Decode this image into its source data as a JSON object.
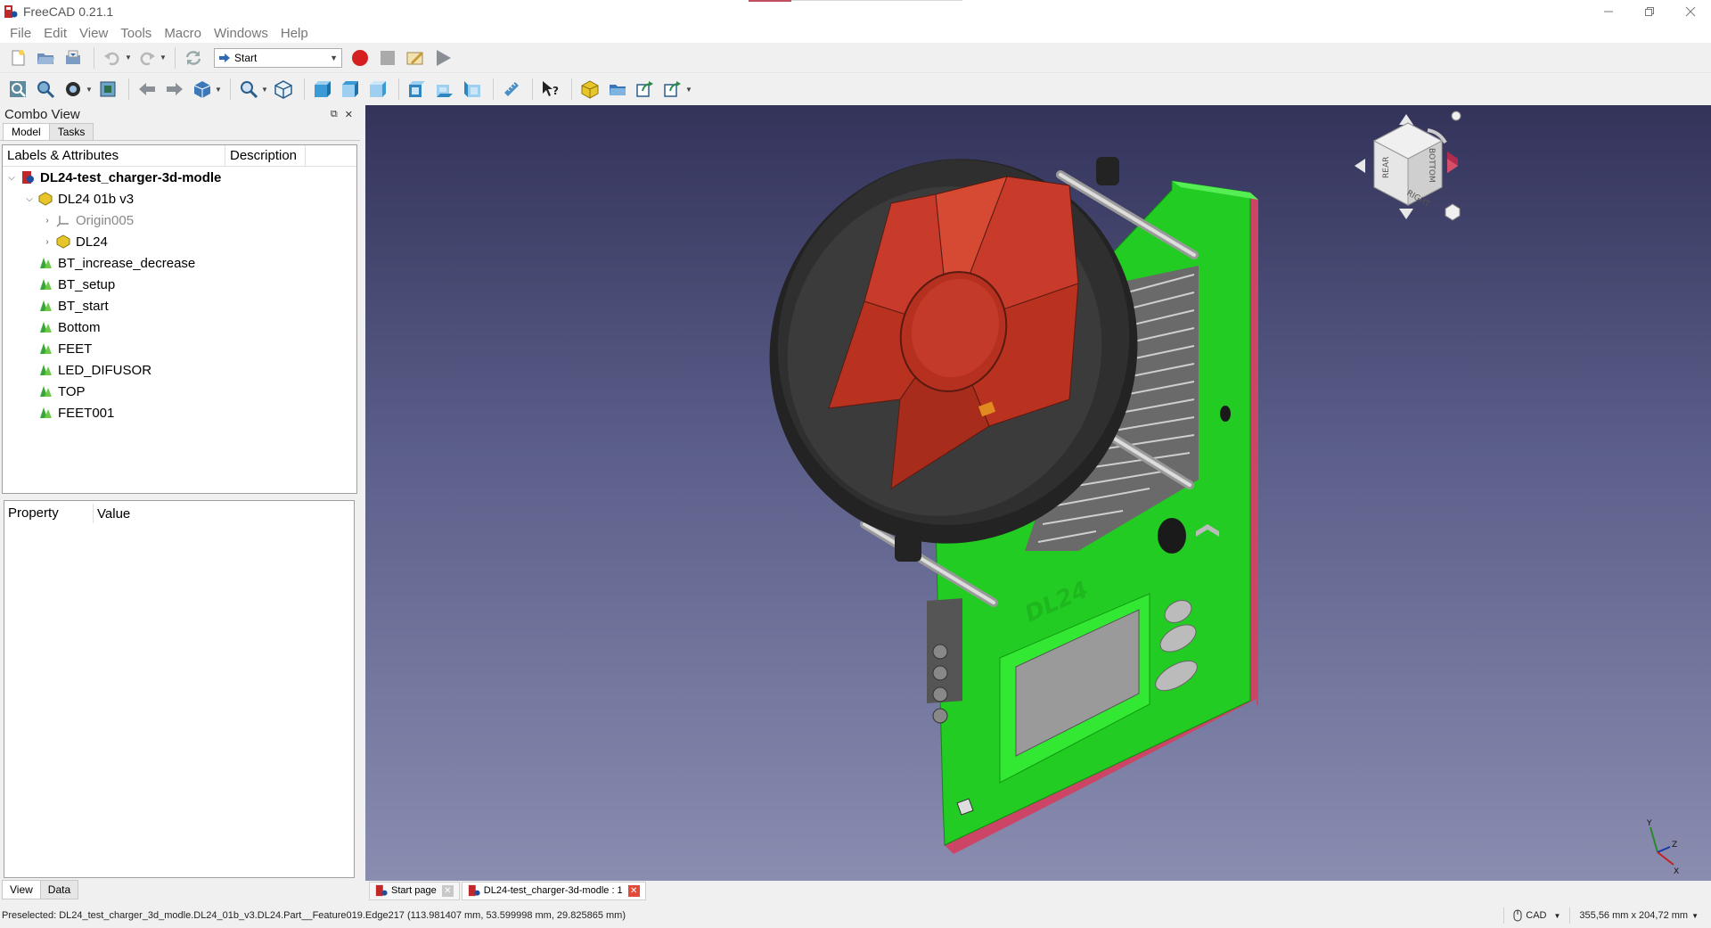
{
  "window": {
    "title": "FreeCAD 0.21.1",
    "controls": [
      "minimize",
      "restore",
      "close"
    ]
  },
  "menubar": {
    "items": [
      "File",
      "Edit",
      "View",
      "Tools",
      "Macro",
      "Windows",
      "Help"
    ]
  },
  "toolbar": {
    "workbench": "Start"
  },
  "combo_view": {
    "title": "Combo View",
    "tabs": [
      "Model",
      "Tasks"
    ],
    "tree_headers": {
      "labels": "Labels & Attributes",
      "description": "Description"
    },
    "tree": [
      {
        "label": "DL24-test_charger-3d-modle",
        "level": 0,
        "expanded": true,
        "icon": "document-icon"
      },
      {
        "label": "DL24 01b v3",
        "level": 1,
        "expanded": true,
        "icon": "part-icon"
      },
      {
        "label": "Origin005",
        "level": 2,
        "expanded": false,
        "icon": "origin-icon"
      },
      {
        "label": "DL24",
        "level": 2,
        "expanded": false,
        "icon": "part-icon"
      },
      {
        "label": "BT_increase_decrease",
        "level": 1,
        "icon": "feature-icon"
      },
      {
        "label": "BT_setup",
        "level": 1,
        "icon": "feature-icon"
      },
      {
        "label": "BT_start",
        "level": 1,
        "icon": "feature-icon"
      },
      {
        "label": "Bottom",
        "level": 1,
        "icon": "feature-icon"
      },
      {
        "label": "FEET",
        "level": 1,
        "icon": "feature-icon"
      },
      {
        "label": "LED_DIFUSOR",
        "level": 1,
        "icon": "feature-icon"
      },
      {
        "label": "TOP",
        "level": 1,
        "icon": "feature-icon"
      },
      {
        "label": "FEET001",
        "level": 1,
        "icon": "feature-icon"
      }
    ],
    "property_headers": {
      "property": "Property",
      "value": "Value"
    },
    "property_tabs": [
      "View",
      "Data"
    ]
  },
  "navcube": {
    "faces": [
      "REAR",
      "BOTTOM",
      "RIGHT"
    ]
  },
  "axis_labels": {
    "y": "Y",
    "z": "Z",
    "x": "X"
  },
  "model_text": "DL24",
  "document_tabs": [
    {
      "label": "Start page",
      "active": false
    },
    {
      "label": "DL24-test_charger-3d-modle : 1",
      "active": true
    }
  ],
  "statusbar": {
    "message": "Preselected: DL24_test_charger_3d_modle.DL24_01b_v3.DL24.Part__Feature019.Edge217 (113.981407 mm, 53.599998 mm, 29.825865 mm)",
    "navigation_style": "CAD",
    "dimensions": "355,56 mm x 204,72 mm"
  },
  "colors": {
    "board_green": "#22cc22",
    "board_edge": "#cc4466",
    "fan_red": "#c83a2a",
    "fan_frame": "#2a2a2a",
    "view_top": "#33335a",
    "view_bottom": "#8a8db0"
  }
}
